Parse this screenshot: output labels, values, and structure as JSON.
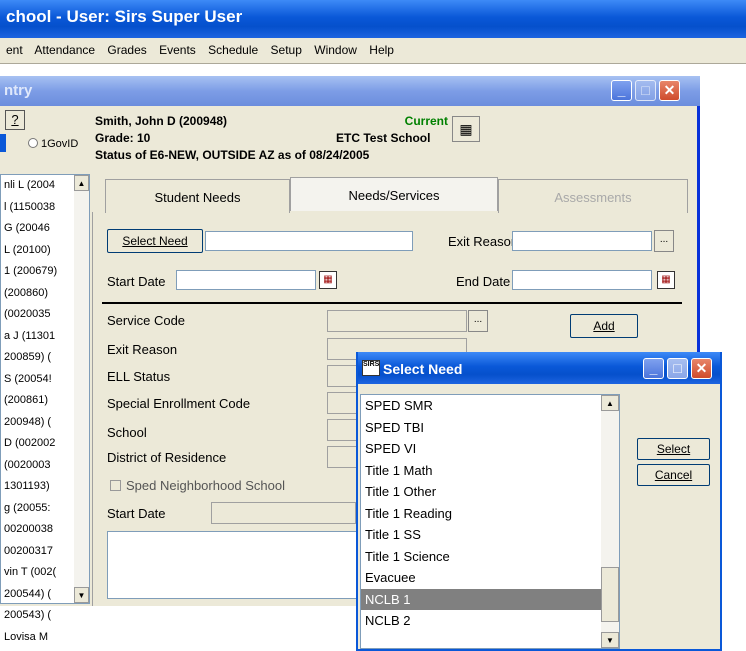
{
  "app": {
    "title": "chool - User: Sirs Super User",
    "menu": [
      "ent",
      "Attendance",
      "Grades",
      "Events",
      "Schedule",
      "Setup",
      "Window",
      "Help"
    ]
  },
  "child_window": {
    "title": "ntry",
    "help_label": "?",
    "radio_label": "1GovID",
    "student_list": [
      "nli L (2004",
      "l (1150038",
      "G (20046",
      "L (20100)",
      "1 (200679)",
      "(200860)",
      "(0020035",
      "a J (11301",
      "200859) (",
      "S (20054!",
      "(200861)",
      "200948) (",
      "D (002002",
      "(0020003",
      "1301193)",
      "g (20055:",
      "00200038",
      "00200317",
      "vin T (002(",
      "200544) (",
      "200543) (",
      "Lovisa M"
    ]
  },
  "student": {
    "name": "Smith, John D (200948)",
    "grade": "Grade: 10",
    "status_text": "Status of E6-NEW, OUTSIDE AZ as of 08/24/2005",
    "current": "Current",
    "school": "ETC Test School"
  },
  "tabs": [
    {
      "label": "Student Needs",
      "state": "normal"
    },
    {
      "label": "Needs/Services",
      "state": "active"
    },
    {
      "label": "Assessments",
      "state": "disabled"
    }
  ],
  "needs_form": {
    "select_need_label": "Select Need",
    "exit_reason_label": "Exit Reason",
    "start_date_label": "Start Date",
    "end_date_label": "End Date",
    "ellipsis": "...",
    "service_code_label": "Service Code",
    "exit_reason2_label": "Exit Reason",
    "ell_status_label": "ELL Status",
    "special_enrollment_label": "Special Enrollment Code",
    "school_label": "School",
    "district_label": "District of Residence",
    "sped_checkbox_label": "Sped Neighborhood School",
    "start_date2_label": "Start Date",
    "add_label": "Add"
  },
  "select_need_dialog": {
    "title": "Select Need",
    "icon_text": "SIRS",
    "options": [
      "SPED SMR",
      "SPED TBI",
      "SPED VI",
      "Title 1 Math",
      "Title 1 Other",
      "Title 1 Reading",
      "Title 1 SS",
      "Title 1 Science",
      "Evacuee",
      "NCLB 1",
      "NCLB 2"
    ],
    "selected_option": "NCLB 1",
    "select_label": "Select",
    "cancel_label": "Cancel"
  }
}
